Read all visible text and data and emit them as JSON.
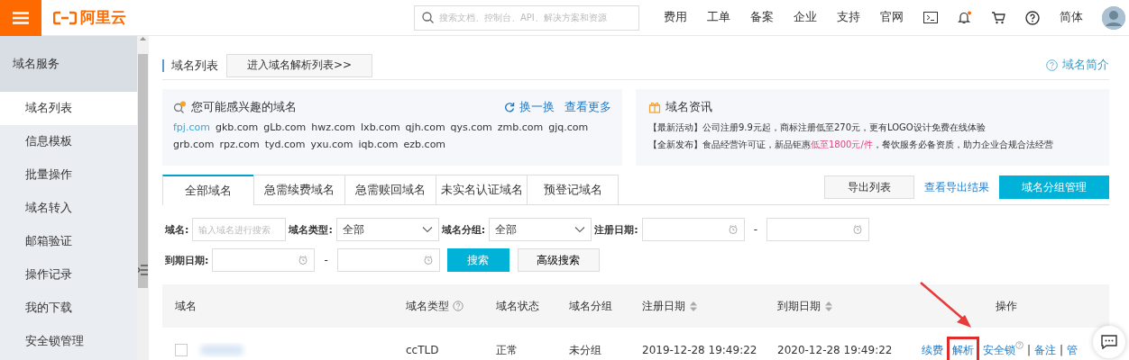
{
  "topbar": {
    "logo": "阿里云",
    "search_placeholder": "搜索文档、控制台、API、解决方案和资源",
    "nav": [
      "费用",
      "工单",
      "备案",
      "企业",
      "支持",
      "官网"
    ],
    "language": "简体"
  },
  "sidebar": {
    "title": "域名服务",
    "items": [
      {
        "label": "域名列表",
        "selected": true
      },
      {
        "label": "信息模板",
        "selected": false
      },
      {
        "label": "批量操作",
        "selected": false
      },
      {
        "label": "域名转入",
        "selected": false
      },
      {
        "label": "邮箱验证",
        "selected": false
      },
      {
        "label": "操作记录",
        "selected": false
      },
      {
        "label": "我的下载",
        "selected": false
      },
      {
        "label": "安全锁管理",
        "selected": false
      }
    ]
  },
  "header": {
    "title": "域名列表",
    "enter_button": "进入域名解析列表>>",
    "help_link": "域名简介"
  },
  "suggest": {
    "title": "您可能感兴趣的域名",
    "refresh": "换一换",
    "more": "查看更多",
    "domains": [
      {
        "name": "fpj.com",
        "selected": true
      },
      {
        "name": "gkb.com",
        "selected": false
      },
      {
        "name": "gLb.com",
        "selected": false
      },
      {
        "name": "hwz.com",
        "selected": false
      },
      {
        "name": "lxb.com",
        "selected": false
      },
      {
        "name": "qjh.com",
        "selected": false
      },
      {
        "name": "qys.com",
        "selected": false
      },
      {
        "name": "zmb.com",
        "selected": false
      },
      {
        "name": "gjq.com",
        "selected": false
      },
      {
        "name": "grb.com",
        "selected": false
      },
      {
        "name": "rpz.com",
        "selected": false
      },
      {
        "name": "tyd.com",
        "selected": false
      },
      {
        "name": "yxu.com",
        "selected": false
      },
      {
        "name": "iqb.com",
        "selected": false
      },
      {
        "name": "ezb.com",
        "selected": false
      }
    ]
  },
  "news": {
    "title": "域名资讯",
    "items": [
      [
        {
          "text": "【最新活动】公司注册9.9元起，商标注册低至270元，更有LOGO设计免费在线体验",
          "emphasis": false
        }
      ],
      [
        {
          "text": "【全新发布】食品经营许可证，新品钜惠",
          "emphasis": false
        },
        {
          "text": "低至1800元/件",
          "emphasis": true
        },
        {
          "text": "，餐饮服务必备资质，助力企业合规合法经营",
          "emphasis": false
        }
      ]
    ]
  },
  "tabs": [
    {
      "label": "全部域名",
      "selected": true
    },
    {
      "label": "急需续费域名",
      "selected": false
    },
    {
      "label": "急需赎回域名",
      "selected": false
    },
    {
      "label": "未实名认证域名",
      "selected": false
    },
    {
      "label": "预登记域名",
      "selected": false
    }
  ],
  "toolbar": {
    "export_button": "导出列表",
    "export_link": "查看导出结果",
    "group_button": "域名分组管理"
  },
  "filters": {
    "domain_label": "域名:",
    "domain_placeholder": "输入域名进行搜索",
    "type_label": "域名类型:",
    "type_value": "全部",
    "group_label": "域名分组:",
    "group_value": "全部",
    "reg_label": "注册日期:",
    "reg_dash": "-",
    "exp_label": "到期日期:",
    "exp_dash": "-",
    "search_button": "搜索",
    "advanced_button": "高级搜索"
  },
  "table": {
    "columns": [
      {
        "label": "域名",
        "help": false,
        "sortable": false
      },
      {
        "label": "域名类型",
        "help": true,
        "sortable": false
      },
      {
        "label": "域名状态",
        "help": false,
        "sortable": false
      },
      {
        "label": "域名分组",
        "help": false,
        "sortable": false
      },
      {
        "label": "注册日期",
        "help": false,
        "sortable": true
      },
      {
        "label": "到期日期",
        "help": false,
        "sortable": true
      },
      {
        "label": "操作",
        "help": false,
        "sortable": false
      }
    ],
    "rows": [
      {
        "checked": false,
        "type": "ccTLD",
        "status": "正常",
        "group": "未分组",
        "registered": "2019-12-28 19:49:22",
        "expires": "2020-12-28 19:49:22",
        "actions": [
          {
            "kind": "link",
            "label": "续费",
            "highlighted": false,
            "help": false
          },
          {
            "kind": "link",
            "label": "解析",
            "highlighted": true,
            "help": false
          },
          {
            "kind": "link",
            "label": "安全锁",
            "highlighted": false,
            "help": true
          },
          {
            "kind": "separator",
            "label": "|"
          },
          {
            "kind": "link",
            "label": "备注",
            "highlighted": false,
            "help": false
          },
          {
            "kind": "separator",
            "label": "|"
          },
          {
            "kind": "link",
            "label": "管",
            "highlighted": false,
            "help": false
          }
        ]
      }
    ]
  }
}
